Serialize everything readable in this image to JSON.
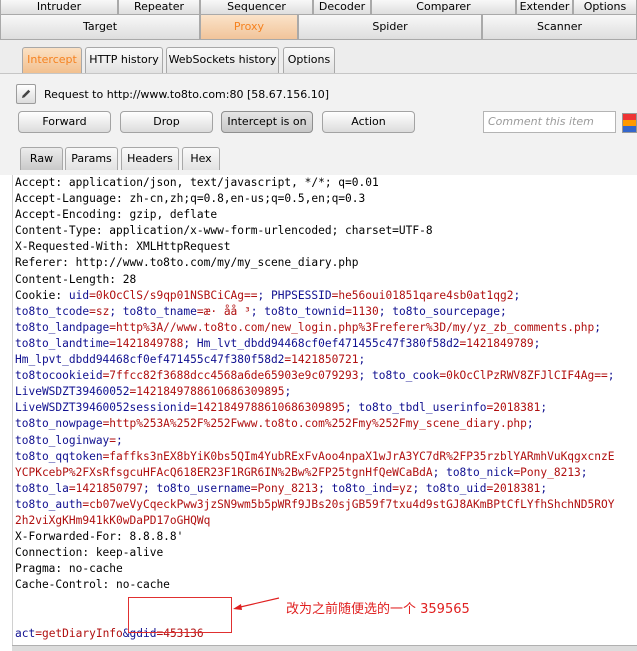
{
  "top_tabs": [
    "Intruder",
    "Repeater",
    "Sequencer",
    "Decoder",
    "Comparer",
    "Extender",
    "Options"
  ],
  "second_tabs": [
    "Target",
    "Proxy",
    "Spider",
    "Scanner"
  ],
  "proxy_tabs": [
    "Intercept",
    "HTTP history",
    "WebSockets history",
    "Options"
  ],
  "request_line": "Request to http://www.to8to.com:80  [58.67.156.10]",
  "buttons": {
    "forward": "Forward",
    "drop": "Drop",
    "intercept": "Intercept is on",
    "action": "Action"
  },
  "comment_placeholder": "Comment this item",
  "message_tabs": [
    "Raw",
    "Params",
    "Headers",
    "Hex"
  ],
  "request_lines": [
    "Accept: application/json, text/javascript, */*; q=0.01",
    "Accept-Language: zh-cn,zh;q=0.8,en-us;q=0.5,en;q=0.3",
    "Accept-Encoding: gzip, deflate",
    "Content-Type: application/x-www-form-urlencoded; charset=UTF-8",
    "X-Requested-With: XMLHttpRequest",
    "Referer: http://www.to8to.com/my/my_scene_diary.php",
    "Content-Length: 28"
  ],
  "cookie": {
    "label": "Cookie: ",
    "lines": [
      [
        [
          "uid",
          "=0kOcClS/s9qp01NSBCiCAg=="
        ],
        [
          "; PHPSESSID",
          "=he56oui01851qare4sb0at1qg2"
        ],
        [
          ";",
          ""
        ]
      ],
      [
        [
          "to8to_tcode",
          "=sz"
        ],
        [
          "; to8to_tname",
          "=æ· åå ³"
        ],
        [
          "; to8to_townid",
          "=1130"
        ],
        [
          "; to8to_sourcepage",
          ""
        ],
        [
          ";",
          ""
        ]
      ],
      [
        [
          "to8to_landpage",
          "=http%3A//www.to8to.com/new_login.php%3Freferer%3D/my/yz_zb_comments.php"
        ],
        [
          ";",
          ""
        ]
      ],
      [
        [
          "to8to_landtime",
          "=1421849788"
        ],
        [
          "; Hm_lvt_dbdd94468cf0ef471455c47f380f58d2",
          "=1421849789"
        ],
        [
          ";",
          ""
        ]
      ],
      [
        [
          "Hm_lpvt_dbdd94468cf0ef471455c47f380f58d2",
          "=1421850721"
        ],
        [
          ";",
          ""
        ]
      ],
      [
        [
          "to8tocookieid",
          "=7ffcc82f3688dcc4568a6de65903e9c079293"
        ],
        [
          "; to8to_cook",
          "=0kOcClPzRWV8ZFJlCIF4Ag=="
        ],
        [
          ";",
          ""
        ]
      ],
      [
        [
          "LiveWSDZT39460052",
          "=1421849788610686309895"
        ],
        [
          ";",
          ""
        ]
      ],
      [
        [
          "LiveWSDZT39460052sessionid",
          "=1421849788610686309895"
        ],
        [
          "; to8to_tbdl_userinfo",
          "=2018381"
        ],
        [
          ";",
          ""
        ]
      ],
      [
        [
          "to8to_nowpage",
          "=http%253A%252F%252Fwww.to8to.com%252Fmy%252Fmy_scene_diary.php"
        ],
        [
          ";",
          ""
        ]
      ],
      [
        [
          "to8to_loginway",
          "="
        ],
        [
          ";",
          ""
        ]
      ],
      [
        [
          "to8to_qqtoken",
          "=faffks3nEX8bYiK0bs5QIm4YubRExFvAoo4npaX1wJrA3YC7dR%2FP35rzblYARmhVuKqgxcnzE"
        ]
      ],
      [
        [
          "",
          "YCPKcebP%2FXsRfsgcuHFAcQ618ER23F1RGR6IN%2Bw%2FP25tgnHfQeWCaBdA"
        ],
        [
          "; to8to_nick",
          "=Pony_8213"
        ],
        [
          ";",
          ""
        ]
      ],
      [
        [
          "to8to_la",
          "=1421850797"
        ],
        [
          "; to8to_username",
          "=Pony_8213"
        ],
        [
          "; to8to_ind",
          "=yz"
        ],
        [
          "; to8to_uid",
          "=2018381"
        ],
        [
          ";",
          ""
        ]
      ],
      [
        [
          "to8to_auth",
          "=cb07weVyCqeckPww3jzSN9wm5b5pWRf9JBs20sjGB59f7txu4d9stGJ8AKmBPtCfLYfhShchND5ROY"
        ]
      ],
      [
        [
          "",
          "2h2viXgKHm941kK0wDaPD17oGHQWq"
        ]
      ]
    ]
  },
  "after_cookie": [
    "X-Forwarded-For: 8.8.8.8'",
    "Connection: keep-alive",
    "Pragma: no-cache",
    "Cache-Control: no-cache"
  ],
  "body_params": [
    [
      "act",
      "=getDiaryInfo"
    ],
    [
      "&gdid",
      "=453136"
    ]
  ],
  "annotation": "改为之前随便选的一个  359565",
  "colors": {
    "accent": "#f58220",
    "key": "#101090",
    "value": "#b01010",
    "annotation": "#e02020"
  }
}
